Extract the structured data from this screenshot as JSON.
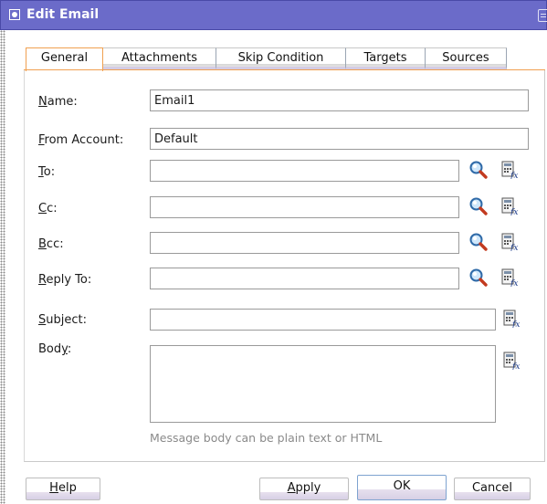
{
  "dialog": {
    "title": "Edit Email"
  },
  "tabs": [
    {
      "label": "General",
      "active": true
    },
    {
      "label": "Attachments",
      "active": false
    },
    {
      "label": "Skip Condition",
      "active": false
    },
    {
      "label": "Targets",
      "active": false
    },
    {
      "label": "Sources",
      "active": false
    }
  ],
  "form": {
    "name": {
      "label": "Name:",
      "mnemonic": "N",
      "rest": "ame:",
      "value": "Email1"
    },
    "from_account": {
      "label": "From Account:",
      "mnemonic": "F",
      "rest": "rom Account:",
      "value": "Default"
    },
    "to": {
      "label": "To:",
      "mnemonic": "T",
      "rest": "o:",
      "value": ""
    },
    "cc": {
      "label": "Cc:",
      "mnemonic": "C",
      "rest": "c:",
      "value": ""
    },
    "bcc": {
      "label": "Bcc:",
      "mnemonic": "B",
      "rest": "cc:",
      "value": ""
    },
    "reply_to": {
      "label": "Reply To:",
      "mnemonic": "R",
      "rest": "eply To:",
      "value": ""
    },
    "subject": {
      "label": "Subject:",
      "mnemonic": "S",
      "rest": "ubject:",
      "value": ""
    },
    "body": {
      "label": "Body:",
      "prefix": "Bod",
      "mnemonic": "y",
      "rest": ":",
      "value": "",
      "hint": "Message body can be plain text or HTML"
    }
  },
  "icons": {
    "search": "magnifier-icon",
    "expression": "expression-builder-icon"
  },
  "buttons": {
    "help": {
      "label": "Help",
      "mnemonic": "H",
      "rest": "elp"
    },
    "apply": {
      "label": "Apply",
      "mnemonic": "A",
      "rest": "pply"
    },
    "ok": {
      "label": "OK"
    },
    "cancel": {
      "label": "Cancel"
    }
  },
  "colors": {
    "titlebar": "#6b6bc9",
    "active_tab_border": "#f0a050",
    "default_button_border": "#7ea3d0"
  }
}
